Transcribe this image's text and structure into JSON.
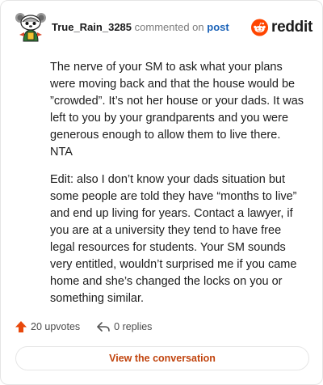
{
  "comment": {
    "username": "True_Rain_3285",
    "commented_on": "commented on",
    "post_link": "post",
    "paragraphs": [
      "The nerve of your SM to ask what your plans were moving back and that the house would be ”crowded”. It’s not her house or your dads. It was left to you by your grandparents and you were generous enough to allow them to live there. NTA",
      "Edit: also I don’t know your dads situation but some people are told they have “months to live” and end up living for years. Contact a lawyer, if you are at a university they tend to have free legal resources for students. Your SM sounds very entitled, wouldn’t surprised me if you came home and she’s changed the locks on you or something similar."
    ]
  },
  "brand": {
    "name": "reddit",
    "color": "#ff4500"
  },
  "stats": {
    "upvotes": "20 upvotes",
    "replies": "0 replies"
  },
  "icons": {
    "avatar": "snoo-avatar-icon",
    "logo": "reddit-logo-icon",
    "upvote": "upvote-arrow-icon",
    "reply": "reply-arrow-icon"
  },
  "actions": {
    "view_conversation": "View the conversation"
  },
  "colors": {
    "accent": "#c1440e",
    "upvote": "#e8480b",
    "link": "#1a62b8"
  }
}
